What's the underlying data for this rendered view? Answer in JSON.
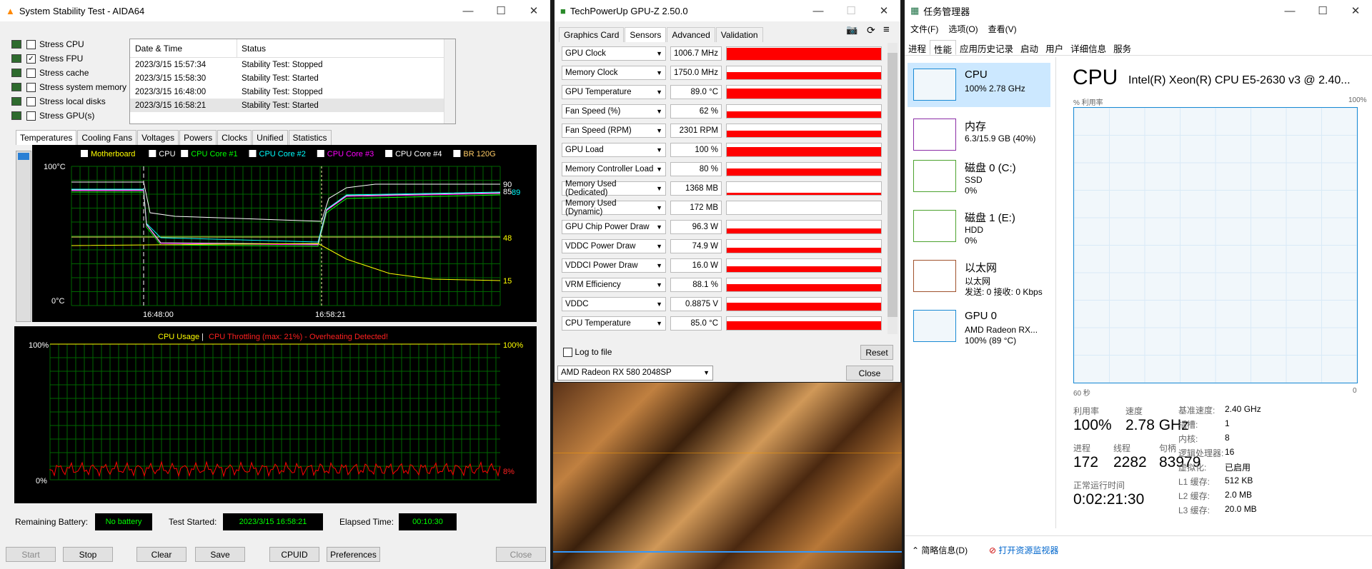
{
  "aida": {
    "title": "System Stability Test - AIDA64",
    "stress": [
      "Stress CPU",
      "Stress FPU",
      "Stress cache",
      "Stress system memory",
      "Stress local disks",
      "Stress GPU(s)"
    ],
    "stress_checked": [
      false,
      true,
      false,
      false,
      false,
      false
    ],
    "log_headers": [
      "Date & Time",
      "Status"
    ],
    "log": [
      [
        "2023/3/15 15:57:34",
        "Stability Test: Stopped"
      ],
      [
        "2023/3/15 15:58:30",
        "Stability Test: Started"
      ],
      [
        "2023/3/15 16:48:00",
        "Stability Test: Stopped"
      ],
      [
        "2023/3/15 16:58:21",
        "Stability Test: Started"
      ]
    ],
    "tabs": [
      "Temperatures",
      "Cooling Fans",
      "Voltages",
      "Powers",
      "Clocks",
      "Unified",
      "Statistics"
    ],
    "legend": [
      "Motherboard",
      "CPU",
      "CPU Core #1",
      "CPU Core #2",
      "CPU Core #3",
      "CPU Core #4",
      "BR 120G"
    ],
    "legend_colors": [
      "#ffff00",
      "#ffffff",
      "#00ff00",
      "#00ffff",
      "#ff00ff",
      "#ffffff",
      "#ffcc66"
    ],
    "temp": {
      "ymax": "100°C",
      "ymin": "0°C",
      "x1": "16:48:00",
      "x2": "16:58:21",
      "r90": "90",
      "r85": "85",
      "r89": "89",
      "r48": "48",
      "r15": "15"
    },
    "usage": {
      "title_a": "CPU Usage",
      "sep": "|",
      "title_b": "CPU Throttling (max: 21%) - Overheating Detected!",
      "ymax": "100%",
      "ymin": "0%",
      "rmax": "100%",
      "rval": "8%"
    },
    "battery_label": "Remaining Battery:",
    "battery": "No battery",
    "started_label": "Test Started:",
    "started": "2023/3/15 16:58:21",
    "elapsed_label": "Elapsed Time:",
    "elapsed": "00:10:30",
    "buttons": [
      "Start",
      "Stop",
      "Clear",
      "Save",
      "CPUID",
      "Preferences",
      "Close"
    ]
  },
  "gpuz": {
    "title": "TechPowerUp GPU-Z 2.50.0",
    "tabs": [
      "Graphics Card",
      "Sensors",
      "Advanced",
      "Validation"
    ],
    "sensors": [
      {
        "n": "GPU Clock",
        "v": "1006.7 MHz",
        "f": 0.9
      },
      {
        "n": "Memory Clock",
        "v": "1750.0 MHz",
        "f": 0.55
      },
      {
        "n": "GPU Temperature",
        "v": "89.0 °C",
        "f": 0.75
      },
      {
        "n": "Fan Speed (%)",
        "v": "62 %",
        "f": 0.45
      },
      {
        "n": "Fan Speed (RPM)",
        "v": "2301 RPM",
        "f": 0.45
      },
      {
        "n": "GPU Load",
        "v": "100 %",
        "f": 0.7
      },
      {
        "n": "Memory Controller Load",
        "v": "80 %",
        "f": 0.55
      },
      {
        "n": "Memory Used (Dedicated)",
        "v": "1368 MB",
        "f": 0.12
      },
      {
        "n": "Memory Used (Dynamic)",
        "v": "172 MB",
        "f": 0.0
      },
      {
        "n": "GPU Chip Power Draw",
        "v": "96.3 W",
        "f": 0.35
      },
      {
        "n": "VDDC Power Draw",
        "v": "74.9 W",
        "f": 0.35
      },
      {
        "n": "VDDCI Power Draw",
        "v": "16.0 W",
        "f": 0.4
      },
      {
        "n": "VRM Efficiency",
        "v": "88.1 %",
        "f": 0.55
      },
      {
        "n": "VDDC",
        "v": "0.8875 V",
        "f": 0.6
      },
      {
        "n": "CPU Temperature",
        "v": "85.0 °C",
        "f": 0.65
      }
    ],
    "log_label": "Log to file",
    "reset": "Reset",
    "gpu": "AMD Radeon RX 580 2048SP",
    "close": "Close"
  },
  "tm": {
    "title": "任务管理器",
    "menu": [
      "文件(F)",
      "选项(O)",
      "查看(V)"
    ],
    "tabs": [
      "进程",
      "性能",
      "应用历史记录",
      "启动",
      "用户",
      "详细信息",
      "服务"
    ],
    "items": [
      {
        "n": "CPU",
        "s1": "100% 2.78 GHz",
        "s2": ""
      },
      {
        "n": "内存",
        "s1": "6.3/15.9 GB (40%)",
        "s2": ""
      },
      {
        "n": "磁盘 0 (C:)",
        "s1": "SSD",
        "s2": "0%"
      },
      {
        "n": "磁盘 1 (E:)",
        "s1": "HDD",
        "s2": "0%"
      },
      {
        "n": "以太网",
        "s1": "以太网",
        "s2": "发送: 0 接收: 0 Kbps"
      },
      {
        "n": "GPU 0",
        "s1": "AMD Radeon RX...",
        "s2": "100% (89 °C)"
      }
    ],
    "header": "CPU",
    "cpu_name": "Intel(R) Xeon(R) CPU E5-2630 v3 @ 2.40...",
    "util_label": "% 利用率",
    "util_max": "100%",
    "x_left": "60 秒",
    "x_right": "0",
    "labels": {
      "util": "利用率",
      "speed": "速度",
      "proc": "进程",
      "threads": "线程",
      "handles": "句柄",
      "uptime": "正常运行时间"
    },
    "values": {
      "util": "100%",
      "speed": "2.78 GHz",
      "proc": "172",
      "threads": "2282",
      "handles": "83979",
      "uptime": "0:02:21:30"
    },
    "right": [
      [
        "基准速度:",
        "2.40 GHz"
      ],
      [
        "插槽:",
        "1"
      ],
      [
        "内核:",
        "8"
      ],
      [
        "逻辑处理器:",
        "16"
      ],
      [
        "虚拟化:",
        "已启用"
      ],
      [
        "L1 缓存:",
        "512 KB"
      ],
      [
        "L2 缓存:",
        "2.0 MB"
      ],
      [
        "L3 缓存:",
        "20.0 MB"
      ]
    ],
    "fewer": "简略信息(D)",
    "monitor": "打开资源监视器"
  }
}
